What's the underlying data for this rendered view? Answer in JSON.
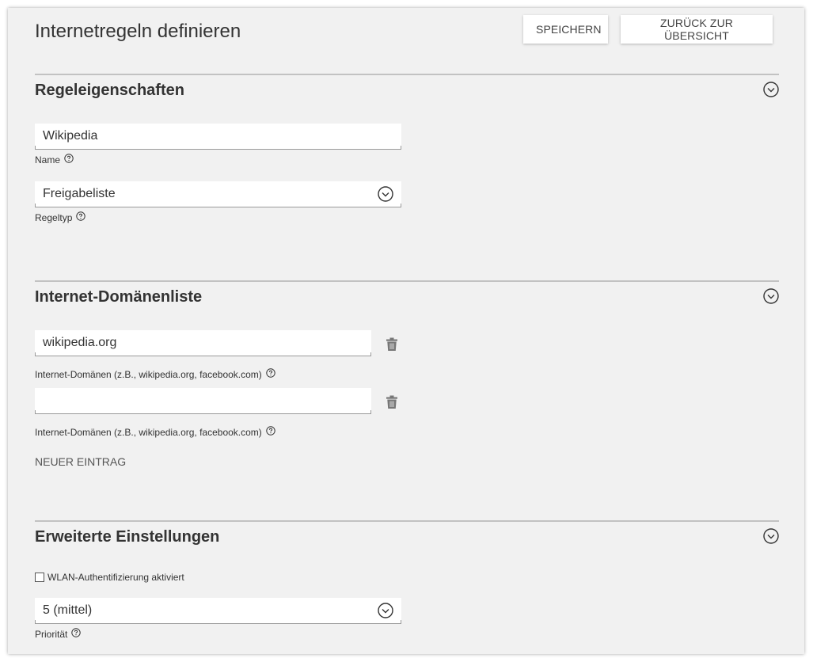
{
  "header": {
    "title": "Internetregeln definieren",
    "save_label": "SPEICHERN",
    "back_label": "ZURÜCK ZUR ÜBERSICHT"
  },
  "rule_properties": {
    "title": "Regeleigenschaften",
    "name_value": "Wikipedia",
    "name_label": "Name",
    "type_value": "Freigabeliste",
    "type_label": "Regeltyp"
  },
  "domain_list": {
    "title": "Internet-Domänenliste",
    "entries": [
      {
        "value": "wikipedia.org",
        "label": "Internet-Domänen (z.B., wikipedia.org, facebook.com)"
      },
      {
        "value": "",
        "label": "Internet-Domänen (z.B., wikipedia.org, facebook.com)"
      }
    ],
    "new_entry_label": "NEUER EINTRAG"
  },
  "advanced": {
    "title": "Erweiterte Einstellungen",
    "wlan_auth_label": "WLAN-Authentifizierung aktiviert",
    "wlan_auth_checked": false,
    "priority_value": "5 (mittel)",
    "priority_label": "Priorität"
  },
  "icons": {
    "collapse": "chevron-circle-icon",
    "dropdown": "chevron-circle-icon",
    "help": "help-circle-icon",
    "delete": "trash-icon"
  }
}
